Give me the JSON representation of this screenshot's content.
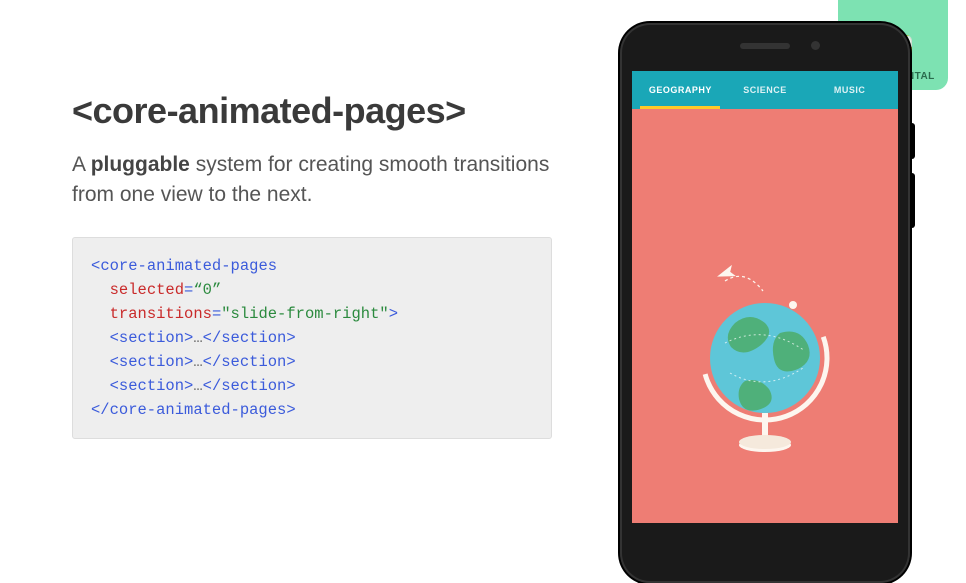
{
  "badge": {
    "label": "EXPERIMENTAL"
  },
  "title": "<core-animated-pages>",
  "subtitle_pre": "A ",
  "subtitle_bold": "pluggable",
  "subtitle_post": " system for creating smooth transitions from one view to the next.",
  "code": {
    "open_tag": "core-animated-pages",
    "attr1_name": "selected",
    "attr1_val": "“0”",
    "attr2_name": "transitions",
    "attr2_val": "\"slide-from-right\"",
    "section_open": "<section>",
    "ellipsis": "…",
    "section_close": "</section>",
    "close_tag": "</core-animated-pages>"
  },
  "phone": {
    "tabs": [
      "GEOGRAPHY",
      "SCIENCE",
      "MUSIC"
    ],
    "active_tab_index": 0
  }
}
